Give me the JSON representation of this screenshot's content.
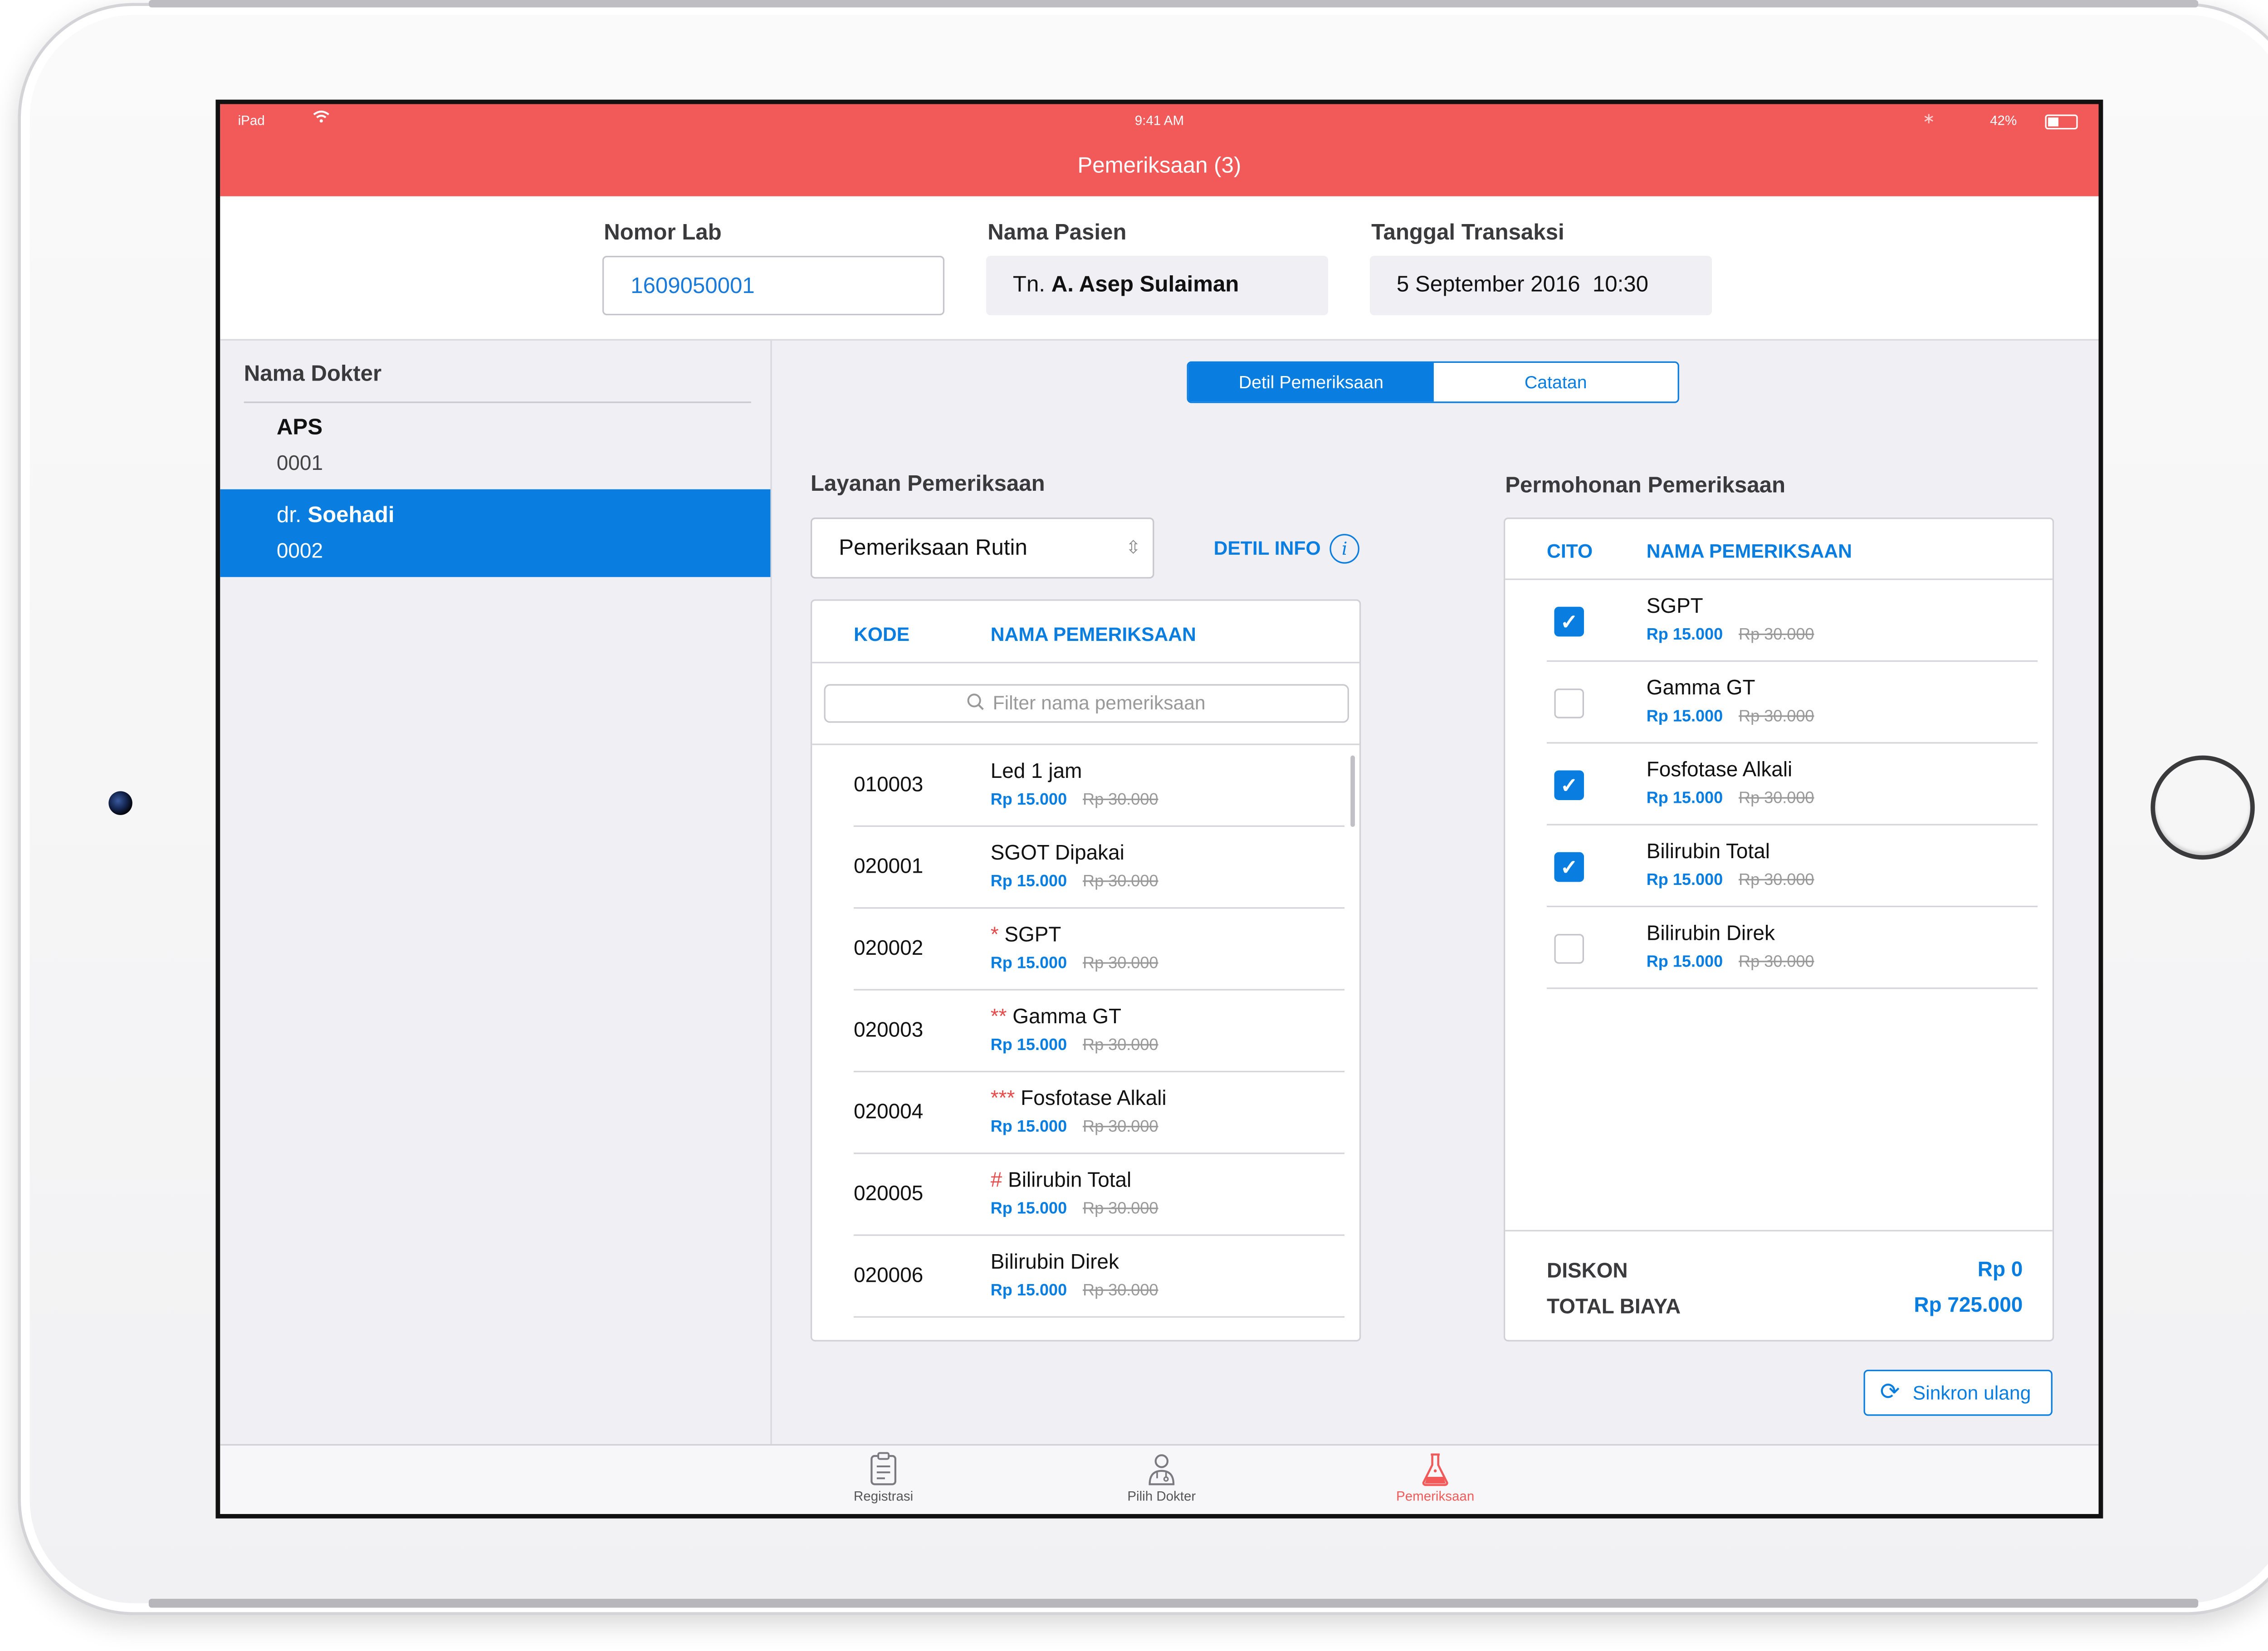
{
  "status_bar": {
    "device": "iPad",
    "time": "9:41 AM",
    "battery": "42%"
  },
  "nav": {
    "title": "Pemeriksaan (3)"
  },
  "header": {
    "lab_label": "Nomor Lab",
    "lab_value": "1609050001",
    "patient_label": "Nama Pasien",
    "patient_prefix": "Tn.",
    "patient_name": "A. Asep Sulaiman",
    "date_label": "Tanggal Transaksi",
    "date_value": "5 September 2016  10:30"
  },
  "sidebar": {
    "title": "Nama Dokter",
    "doctors": [
      {
        "prefix": "",
        "name": "APS",
        "code": "0001",
        "selected": false
      },
      {
        "prefix": "dr.",
        "name": "Soehadi",
        "code": "0002",
        "selected": true
      }
    ]
  },
  "segments": {
    "active": "Detil Pemeriksaan",
    "inactive": "Catatan"
  },
  "services": {
    "title": "Layanan Pemeriksaan",
    "selected": "Pemeriksaan Rutin",
    "detail_link": "DETIL INFO",
    "col_code": "KODE",
    "col_name": "NAMA PEMERIKSAAN",
    "filter_placeholder": "Filter nama pemeriksaan",
    "rows": [
      {
        "code": "010003",
        "mark": "",
        "name": "Led 1 jam",
        "price": "Rp 15.000",
        "old_price": "Rp 30.000"
      },
      {
        "code": "020001",
        "mark": "",
        "name": "SGOT Dipakai",
        "price": "Rp 15.000",
        "old_price": "Rp 30.000"
      },
      {
        "code": "020002",
        "mark": "*",
        "name": "SGPT",
        "price": "Rp 15.000",
        "old_price": "Rp 30.000"
      },
      {
        "code": "020003",
        "mark": "**",
        "name": "Gamma GT",
        "price": "Rp 15.000",
        "old_price": "Rp 30.000"
      },
      {
        "code": "020004",
        "mark": "***",
        "name": "Fosfotase Alkali",
        "price": "Rp 15.000",
        "old_price": "Rp 30.000"
      },
      {
        "code": "020005",
        "mark": "#",
        "name": "Bilirubin Total",
        "price": "Rp 15.000",
        "old_price": "Rp 30.000"
      },
      {
        "code": "020006",
        "mark": "",
        "name": "Bilirubin Direk",
        "price": "Rp 15.000",
        "old_price": "Rp 30.000"
      }
    ]
  },
  "requests": {
    "title": "Permohonan Pemeriksaan",
    "col_cito": "CITO",
    "col_name": "NAMA PEMERIKSAAN",
    "rows": [
      {
        "checked": true,
        "name": "SGPT",
        "price": "Rp 15.000",
        "old_price": "Rp 30.000"
      },
      {
        "checked": false,
        "name": "Gamma GT",
        "price": "Rp 15.000",
        "old_price": "Rp 30.000"
      },
      {
        "checked": true,
        "name": "Fosfotase Alkali",
        "price": "Rp 15.000",
        "old_price": "Rp 30.000"
      },
      {
        "checked": true,
        "name": "Bilirubin Total",
        "price": "Rp 15.000",
        "old_price": "Rp 30.000"
      },
      {
        "checked": false,
        "name": "Bilirubin Direk",
        "price": "Rp 15.000",
        "old_price": "Rp 30.000"
      }
    ],
    "discount_label": "DISKON",
    "discount_value": "Rp 0",
    "total_label": "TOTAL BIAYA",
    "total_value": "Rp 725.000"
  },
  "sync_button": "Sinkron ulang",
  "tabs": [
    {
      "label": "Registrasi",
      "icon": "clipboard-icon",
      "active": false
    },
    {
      "label": "Pilih Dokter",
      "icon": "doctor-icon",
      "active": false
    },
    {
      "label": "Pemeriksaan",
      "icon": "flask-icon",
      "active": true
    }
  ],
  "colors": {
    "brand_red": "#f25a5a",
    "accent_blue": "#0a7ee0",
    "background": "#efeff4"
  }
}
